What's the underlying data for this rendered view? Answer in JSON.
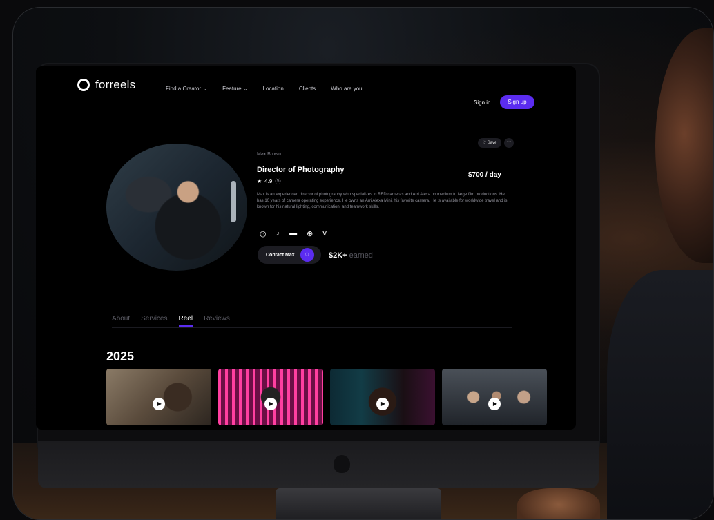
{
  "brand": {
    "name": "forreels"
  },
  "nav": {
    "links": [
      "Find a Creator ⌄",
      "Feature ⌄",
      "Location",
      "Clients",
      "Who are you"
    ],
    "signin": "Sign in",
    "signup": "Sign up"
  },
  "profile": {
    "name": "Max Brown",
    "role": "Director of Photography",
    "price": "$700 / day",
    "rating": "4.9",
    "rating_count": "(5)",
    "bio": "Max is an experienced director of photography who specializes in RED cameras and Arri Alexa on medium to large film productions. He has 10 years of camera operating experience. He owns an Arri Alexa Mini, his favorite camera. He is available for worldwide travel and is known for his natural lighting, communication, and teamwork skills.",
    "save_label": "Save",
    "more_label": "···",
    "contact_label": "Contact Max",
    "earned_value": "$2K+",
    "earned_label": "earned"
  },
  "socials": [
    "instagram-icon",
    "tiktok-icon",
    "imdb-icon",
    "globe-icon",
    "vimeo-icon"
  ],
  "tabs": [
    "About",
    "Services",
    "Reel",
    "Reviews"
  ],
  "active_tab": "Reel",
  "reel": {
    "year": "2025"
  },
  "colors": {
    "accent": "#5b2cf0",
    "background": "#000000"
  }
}
